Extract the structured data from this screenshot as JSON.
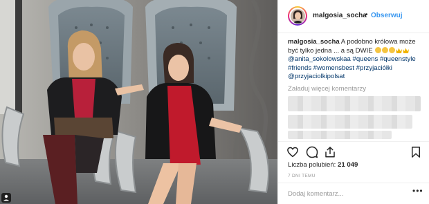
{
  "header": {
    "username": "malgosia_socha",
    "separator": "•",
    "follow_label": "Obserwuj"
  },
  "caption": {
    "username": "malgosia_socha",
    "line1_text": " A podobno królowa może",
    "line2_text": "być tylko jedna ... a są DWIE",
    "line3_mention": "@anita_sokolowskaa",
    "line3_tags": [
      " #queens",
      " #queenstyle"
    ],
    "line4_tags": [
      "#friends",
      " #womensbest",
      " #przyjaciółki"
    ],
    "line5_mention": "@przyjaciolkipolsat"
  },
  "comments": {
    "load_more_label": "Załaduj więcej komentarzy"
  },
  "stats": {
    "likes_label": "Liczba polubień: ",
    "likes_count": "21 049",
    "time_ago": "7 DNI TEMU"
  },
  "comment_box": {
    "placeholder": "Dodaj komentarz...",
    "menu_label": "•••"
  },
  "icons": {
    "like": "heart-icon",
    "comment": "comment-icon",
    "share": "share-icon",
    "save": "bookmark-icon",
    "photo_badge": "user-tag-icon"
  },
  "colors": {
    "link": "#003569",
    "follow": "#3897f0",
    "muted": "#999999",
    "text": "#262626"
  }
}
